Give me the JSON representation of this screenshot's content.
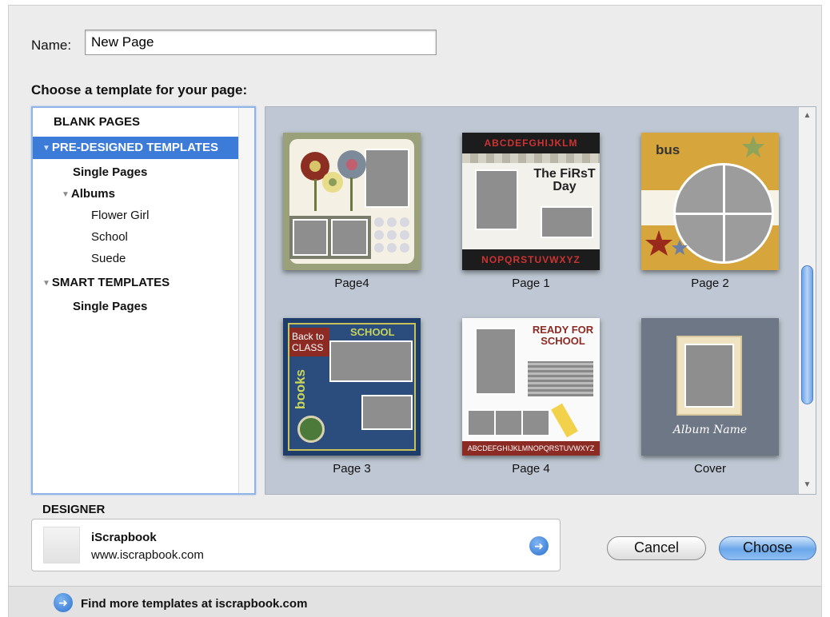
{
  "name_field": {
    "label": "Name:",
    "value": "New Page"
  },
  "template_heading": "Choose a template for your page:",
  "tree": {
    "blank_pages": "BLANK PAGES",
    "pre_designed": "PRE-DESIGNED TEMPLATES",
    "single_pages_1": "Single Pages",
    "albums": "Albums",
    "album_items": [
      "Flower Girl",
      "School",
      "Suede"
    ],
    "smart_templates": "SMART TEMPLATES",
    "single_pages_2": "Single Pages"
  },
  "templates": [
    {
      "label": "Page4"
    },
    {
      "label": "Page 1",
      "text_top": "ABCDEFGHIJKLM",
      "text_title": "The FiRsT Day",
      "text_bottom": "NOPQRSTUVWXYZ"
    },
    {
      "label": "Page 2",
      "text_title": "bus"
    },
    {
      "label": "Page 3",
      "text_tag": "Back to CLASS",
      "text_school": "SCHOOL",
      "text_books": "books"
    },
    {
      "label": "Page 4",
      "text_title": "READY FOR SCHOOL",
      "text_bottom": "ABCDEFGHIJKLMNOPQRSTUVWXYZ"
    },
    {
      "label": "Cover",
      "text_script": "Album Name"
    }
  ],
  "designer": {
    "heading": "DESIGNER",
    "name": "iScrapbook",
    "url": "www.iscrapbook.com"
  },
  "buttons": {
    "cancel": "Cancel",
    "choose": "Choose"
  },
  "footer": {
    "text": "Find more templates at iscrapbook.com"
  },
  "colors": {
    "selection": "#3d7bd9",
    "grid_background": "#bec7d3",
    "accent_blue": "#2c6fcf"
  }
}
